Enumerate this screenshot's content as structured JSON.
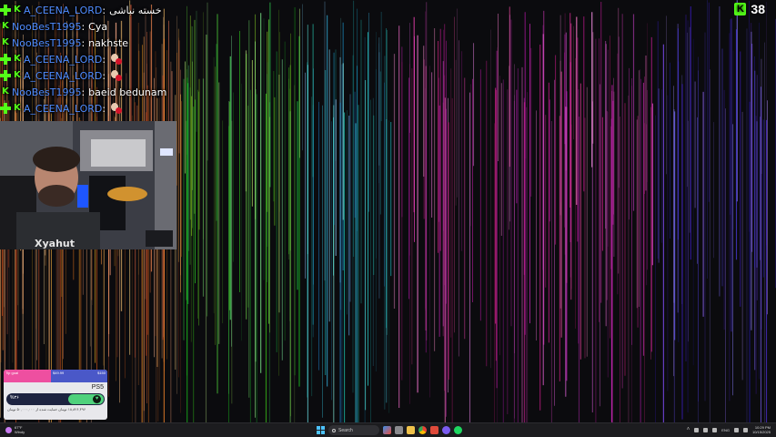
{
  "chat": {
    "messages": [
      {
        "user": "A_CEENA_LORD",
        "badges": [
          "plus",
          "kick"
        ],
        "text": "خسته نباشی",
        "emote": false
      },
      {
        "user": "NooBesT1995",
        "badges": [
          "kick"
        ],
        "text": "Cya",
        "emote": false
      },
      {
        "user": "NooBesT1995",
        "badges": [
          "kick"
        ],
        "text": "nakhste",
        "emote": false
      },
      {
        "user": "A_CEENA_LORD",
        "badges": [
          "plus",
          "kick"
        ],
        "text": "",
        "emote": true
      },
      {
        "user": "A_CEENA_LORD",
        "badges": [
          "plus",
          "kick"
        ],
        "text": "",
        "emote": true
      },
      {
        "user": "NooBesT1995",
        "badges": [
          "kick"
        ],
        "text": "baeid bedunam",
        "emote": false
      },
      {
        "user": "A_CEENA_LORD",
        "badges": [
          "plus",
          "kick"
        ],
        "text": "",
        "emote": true
      }
    ],
    "colon": ":"
  },
  "viewers": {
    "count": "38",
    "logo": "K"
  },
  "goal": {
    "tip_label": "Tip goal",
    "left_amount": "$49.99",
    "right_amount": "$150",
    "title": "PS5",
    "percent": "%۳۶",
    "footer": "۱۸,۸۲۶,۳۹۶ تومان حمایت شده از ۵۰,۰۰۰,۰۰۰ تومان",
    "progress_fraction": 0.36
  },
  "taskbar": {
    "weather_temp": "67°F",
    "weather_desc": "Windy",
    "search_placeholder": "Search",
    "lang": "ENG",
    "time": "10:29 PM",
    "date": "10/15/2025"
  },
  "colors": {
    "kick_green": "#53fc18",
    "username_blue": "#4f8cff"
  }
}
